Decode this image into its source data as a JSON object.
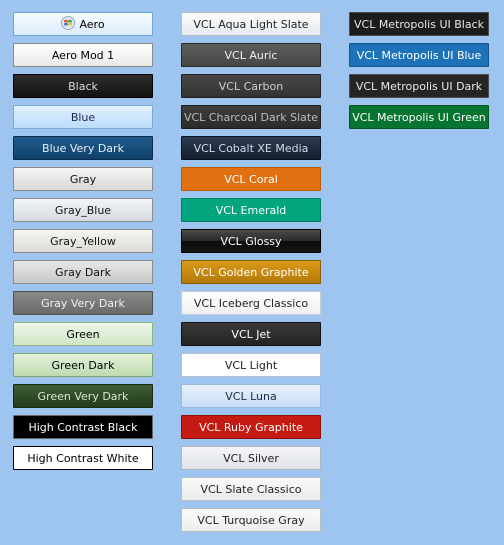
{
  "columns": [
    [
      {
        "name": "btn-style-aero",
        "style": "s-aero",
        "label": "Aero",
        "icon": "windows-logo-icon"
      },
      {
        "name": "btn-style-aero-mod-1",
        "style": "s-aeromod1",
        "label": "Aero Mod 1"
      },
      {
        "name": "btn-style-black",
        "style": "s-black",
        "label": "Black"
      },
      {
        "name": "btn-style-blue",
        "style": "s-blue",
        "label": "Blue"
      },
      {
        "name": "btn-style-blue-very-dark",
        "style": "s-blueverydark",
        "label": "Blue Very Dark"
      },
      {
        "name": "btn-style-gray",
        "style": "s-gray",
        "label": "Gray"
      },
      {
        "name": "btn-style-gray-blue",
        "style": "s-graybl",
        "label": "Gray_Blue"
      },
      {
        "name": "btn-style-gray-yellow",
        "style": "s-grayyl",
        "label": "Gray_Yellow"
      },
      {
        "name": "btn-style-gray-dark",
        "style": "s-graydark",
        "label": "Gray Dark"
      },
      {
        "name": "btn-style-gray-very-dark",
        "style": "s-grayverydark",
        "label": "Gray Very Dark"
      },
      {
        "name": "btn-style-green",
        "style": "s-green",
        "label": "Green"
      },
      {
        "name": "btn-style-green-dark",
        "style": "s-greendark",
        "label": "Green Dark"
      },
      {
        "name": "btn-style-green-very-dark",
        "style": "s-greenverydark",
        "label": "Green Very Dark"
      },
      {
        "name": "btn-style-high-contrast-black",
        "style": "s-hcblack",
        "label": "High Contrast Black"
      },
      {
        "name": "btn-style-high-contrast-white",
        "style": "s-hcwhite",
        "label": "High Contrast White"
      }
    ],
    [
      {
        "name": "btn-style-vcl-aqua-light-slate",
        "style": "s-aqualight",
        "label": "VCL Aqua Light Slate"
      },
      {
        "name": "btn-style-vcl-auric",
        "style": "s-auric",
        "label": "VCL Auric"
      },
      {
        "name": "btn-style-vcl-carbon",
        "style": "s-carbon",
        "label": "VCL Carbon"
      },
      {
        "name": "btn-style-vcl-charcoal-dark-slate",
        "style": "s-charcoal",
        "label": "VCL Charcoal Dark Slate"
      },
      {
        "name": "btn-style-vcl-cobalt-xe-media",
        "style": "s-cobalt",
        "label": "VCL Cobalt XE Media"
      },
      {
        "name": "btn-style-vcl-coral",
        "style": "s-coral",
        "label": "VCL Coral"
      },
      {
        "name": "btn-style-vcl-emerald",
        "style": "s-emerald",
        "label": "VCL Emerald"
      },
      {
        "name": "btn-style-vcl-glossy",
        "style": "s-glossy",
        "label": "VCL Glossy"
      },
      {
        "name": "btn-style-vcl-golden-graphite",
        "style": "s-golden",
        "label": "VCL Golden Graphite"
      },
      {
        "name": "btn-style-vcl-iceberg-classico",
        "style": "s-iceberg",
        "label": "VCL Iceberg Classico"
      },
      {
        "name": "btn-style-vcl-jet",
        "style": "s-jet",
        "label": "VCL Jet"
      },
      {
        "name": "btn-style-vcl-light",
        "style": "s-light",
        "label": "VCL Light"
      },
      {
        "name": "btn-style-vcl-luna",
        "style": "s-luna",
        "label": "VCL Luna"
      },
      {
        "name": "btn-style-vcl-ruby-graphite",
        "style": "s-ruby",
        "label": "VCL Ruby Graphite"
      },
      {
        "name": "btn-style-vcl-silver",
        "style": "s-silver",
        "label": "VCL Silver"
      },
      {
        "name": "btn-style-vcl-slate-classico",
        "style": "s-slate",
        "label": "VCL Slate Classico"
      },
      {
        "name": "btn-style-vcl-turquoise-gray",
        "style": "s-turq",
        "label": "VCL Turquoise Gray"
      }
    ],
    [
      {
        "name": "btn-style-vcl-metropolis-ui-black",
        "style": "s-metblack",
        "label": "VCL Metropolis UI Black"
      },
      {
        "name": "btn-style-vcl-metropolis-ui-blue",
        "style": "s-metblue",
        "label": "VCL Metropolis UI Blue"
      },
      {
        "name": "btn-style-vcl-metropolis-ui-dark",
        "style": "s-metdark",
        "label": "VCL Metropolis UI Dark"
      },
      {
        "name": "btn-style-vcl-metropolis-ui-green",
        "style": "s-metgreen",
        "label": "VCL Metropolis UI Green"
      }
    ]
  ],
  "colors": {
    "background": "#9ec5f0",
    "coral": "#e07010",
    "emerald": "#03a57e",
    "ruby": "#c41a12",
    "metropolis_blue": "#1e73b8",
    "metropolis_green": "#07752f"
  }
}
